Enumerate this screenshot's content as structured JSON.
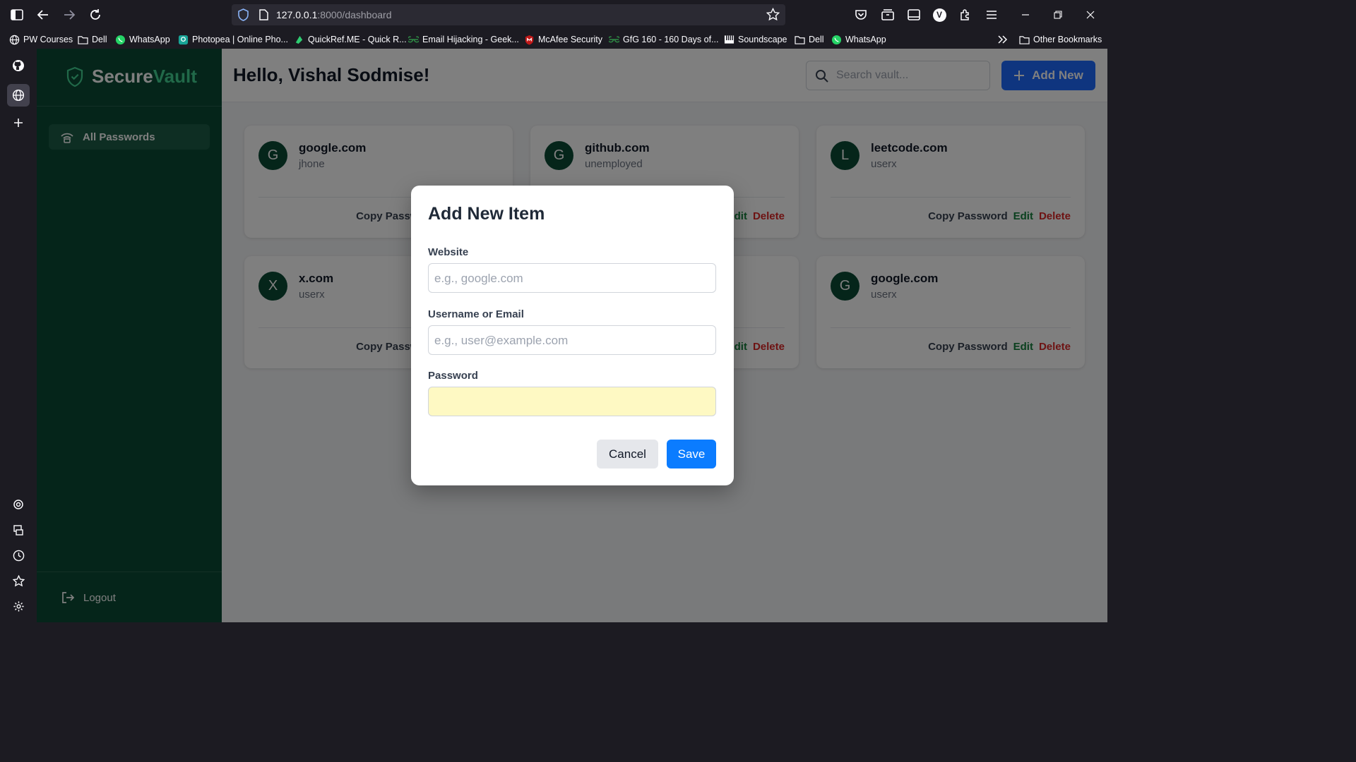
{
  "browser": {
    "url_host": "127.0.0.1",
    "url_path": ":8000/dashboard",
    "bookmarks": [
      {
        "label": "PW Courses",
        "icon": "globe-icon"
      },
      {
        "label": "Dell",
        "icon": "folder-icon"
      },
      {
        "label": "WhatsApp",
        "icon": "whatsapp-icon"
      },
      {
        "label": "Photopea | Online Pho...",
        "icon": "photopea-icon"
      },
      {
        "label": "QuickRef.ME - Quick R...",
        "icon": "quickref-icon"
      },
      {
        "label": "Email Hijacking - Geek...",
        "icon": "gfg-icon"
      },
      {
        "label": "McAfee Security",
        "icon": "mcafee-icon"
      },
      {
        "label": "GfG 160 - 160 Days of...",
        "icon": "gfg-icon"
      },
      {
        "label": "Soundscape",
        "icon": "piano-icon"
      },
      {
        "label": "Dell",
        "icon": "folder-icon"
      },
      {
        "label": "WhatsApp",
        "icon": "whatsapp-icon"
      }
    ],
    "other_bookmarks": "Other Bookmarks",
    "profile_initial": "V"
  },
  "app": {
    "brand_main": "Secure",
    "brand_accent": "Vault",
    "nav_all": "All Passwords",
    "logout": "Logout",
    "greeting": "Hello, Vishal Sodmise!",
    "search_placeholder": "Search vault...",
    "add_new": "Add New",
    "actions": {
      "copy": "Copy Password",
      "edit": "Edit",
      "delete": "Delete"
    },
    "cards": [
      {
        "initial": "G",
        "site": "google.com",
        "user": "jhone"
      },
      {
        "initial": "G",
        "site": "github.com",
        "user": "unemployed"
      },
      {
        "initial": "L",
        "site": "leetcode.com",
        "user": "userx"
      },
      {
        "initial": "X",
        "site": "x.com",
        "user": "userx"
      },
      {
        "initial": "G",
        "site": "google.com",
        "user": "userx"
      }
    ]
  },
  "modal": {
    "title": "Add New Item",
    "website_label": "Website",
    "website_placeholder": "e.g., google.com",
    "user_label": "Username or Email",
    "user_placeholder": "e.g., user@example.com",
    "password_label": "Password",
    "cancel": "Cancel",
    "save": "Save"
  },
  "colors": {
    "sidebar": "#0b4a35",
    "brand_accent": "#42d392",
    "primary": "#1e6bff",
    "edit": "#15803d",
    "delete": "#dc2626",
    "password_field": "#fef9c3"
  }
}
